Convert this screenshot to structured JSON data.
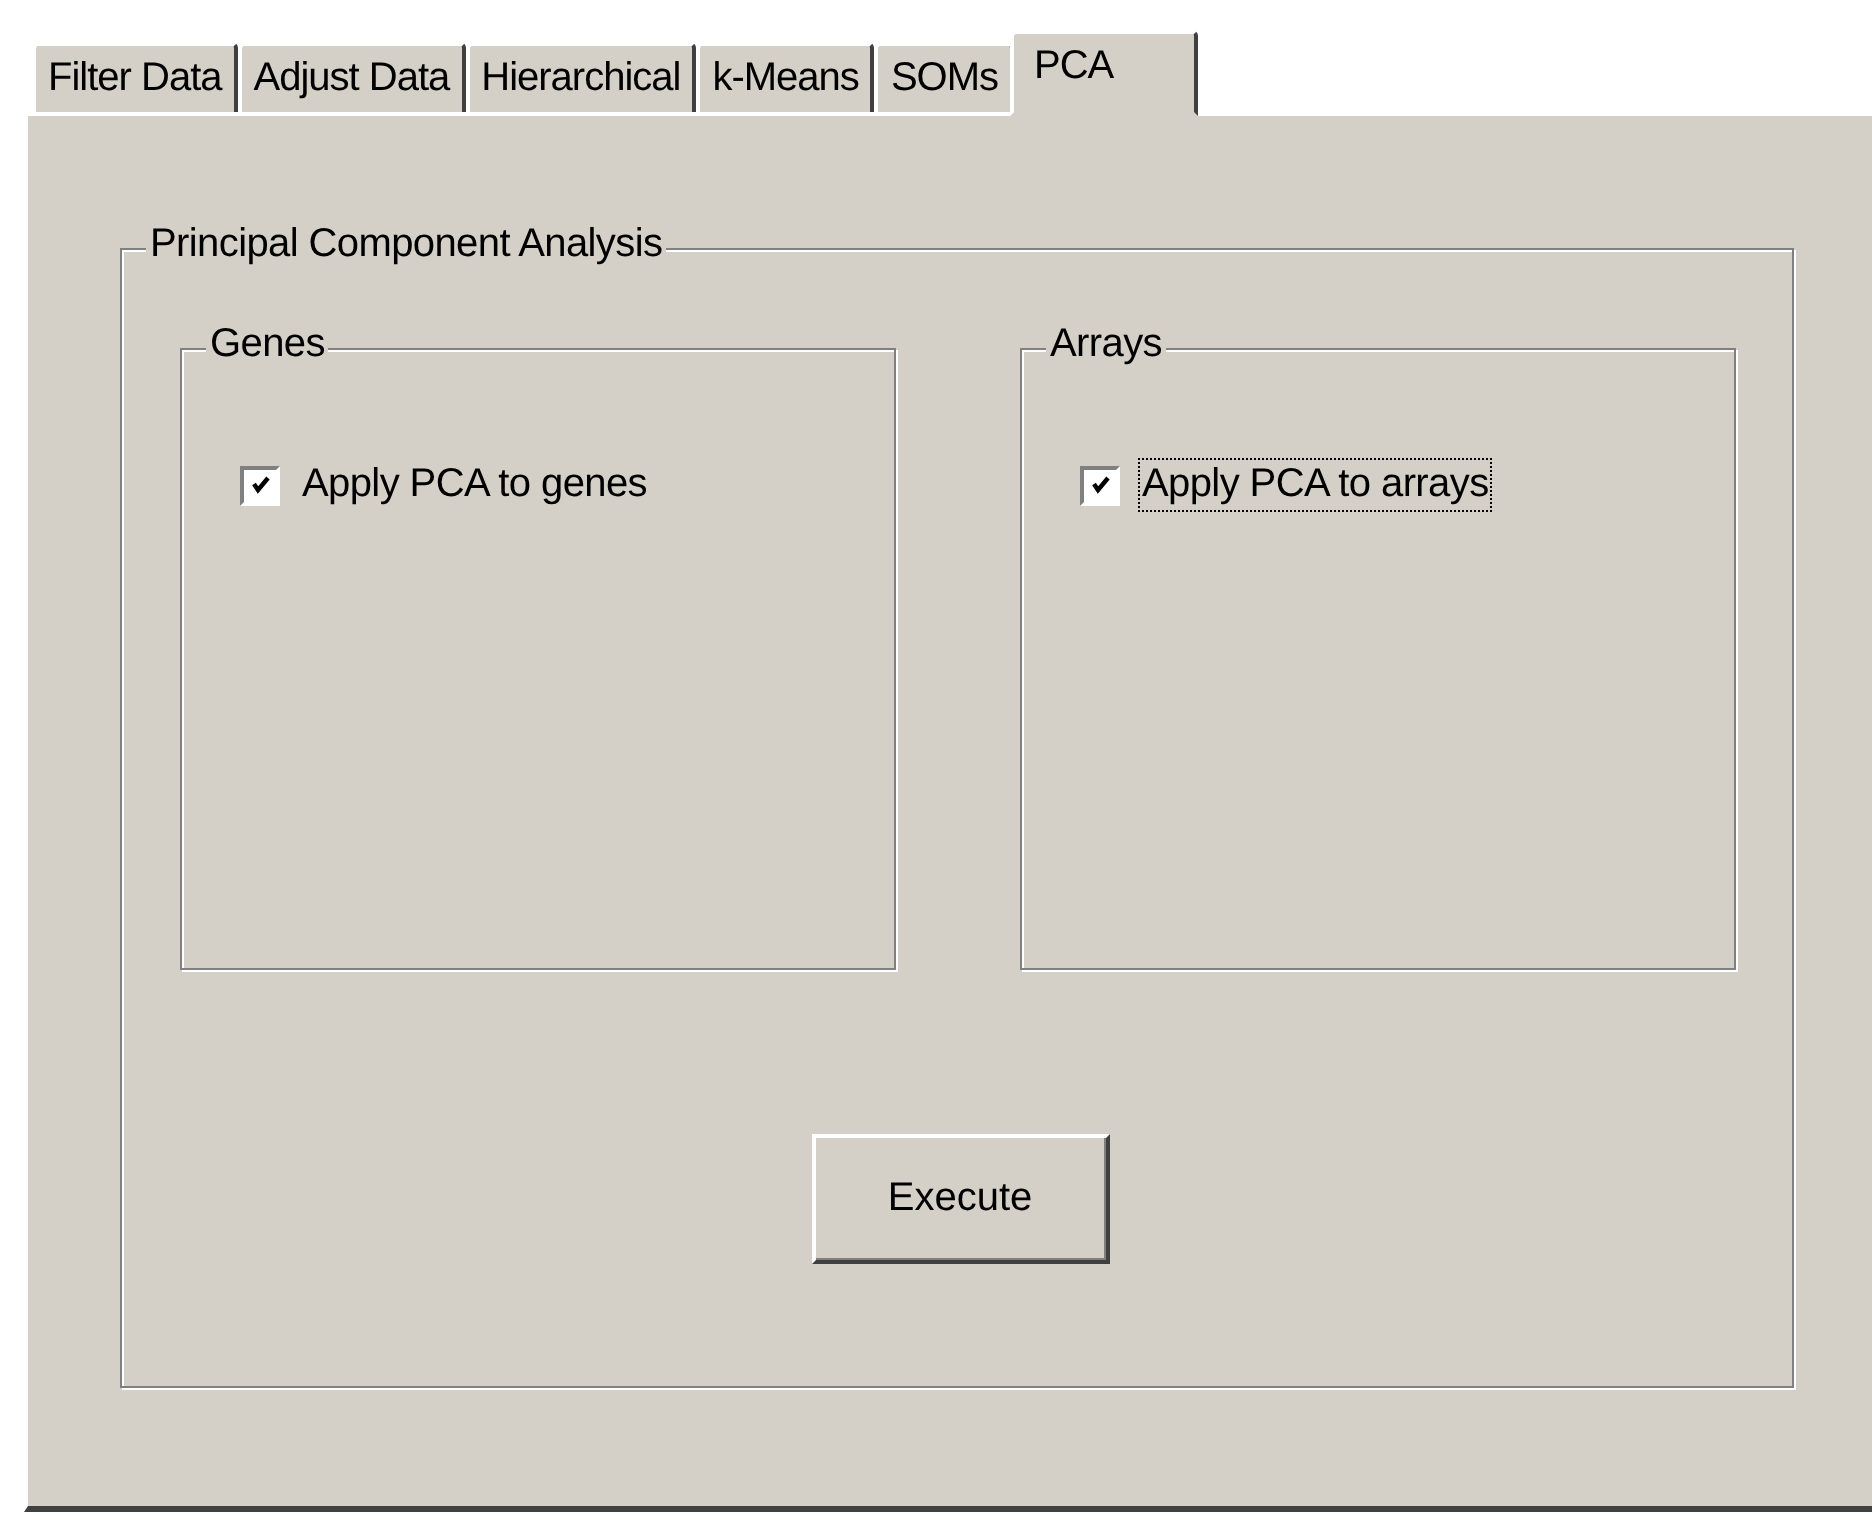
{
  "tabs": [
    {
      "label": "Filter Data",
      "selected": false
    },
    {
      "label": "Adjust Data",
      "selected": false
    },
    {
      "label": "Hierarchical",
      "selected": false
    },
    {
      "label": "k-Means",
      "selected": false
    },
    {
      "label": "SOMs",
      "selected": false
    },
    {
      "label": "PCA",
      "selected": true
    }
  ],
  "group": {
    "title": "Principal Component Analysis",
    "subgroups": [
      {
        "title": "Genes",
        "checkbox": {
          "label": "Apply PCA to genes",
          "checked": true,
          "focused": false
        }
      },
      {
        "title": "Arrays",
        "checkbox": {
          "label": "Apply PCA to arrays",
          "checked": true,
          "focused": true
        }
      }
    ],
    "button": "Execute"
  }
}
